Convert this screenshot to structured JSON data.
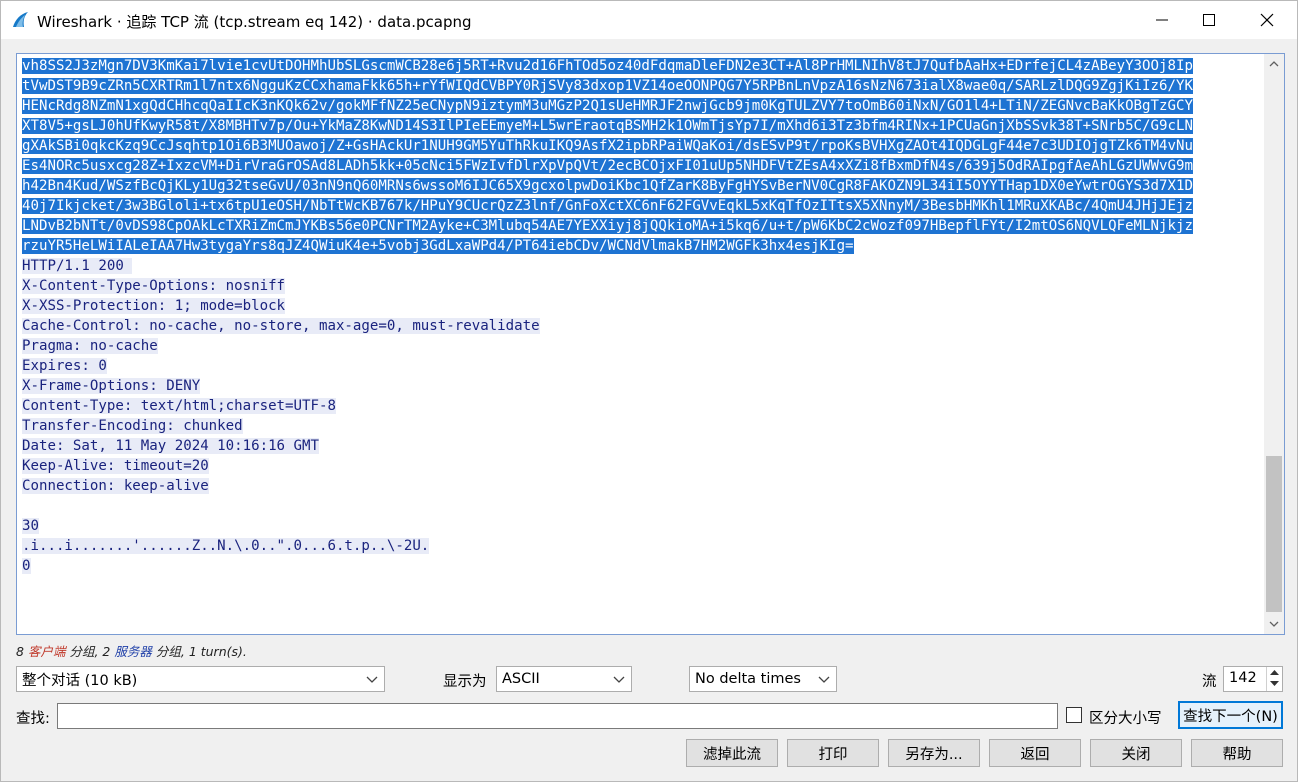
{
  "window": {
    "title": "Wireshark · 追踪 TCP 流 (tcp.stream eq 142) · data.pcapng"
  },
  "stream": {
    "client_lines": [
      "vh8SS2J3zMgn7DV3KmKai7lvie1cvUtDOHMhUbSLGscmWCB28e6j5RT+Rvu2d16FhTOd5oz40dFdqmaDleFDN2e3CT+Al8PrHMLNIhV8tJ7QufbAaHx+EDrfejCL4zABeyY3OOj8Ip",
      "tVwDST9B9cZRn5CXRTRm1l7ntx6NgguKzCCxhamaFkk65h+rYfWIQdCVBPY0RjSVy83dxop1VZ14oeOONPQG7Y5RPBnLnVpzA16sNzN673ialX8wae0q/SARLzlDQG9ZgjKiIz6/YK",
      "HENcRdg8NZmN1xgQdCHhcqQaIIcK3nKQk62v/gokMFfNZ25eCNypN9iztymM3uMGzP2Q1sUeHMRJF2nwjGcb9jm0KgTULZVY7toOmB60iNxN/GO1l4+LTiN/ZEGNvcBaKkOBgTzGCY",
      "XT8V5+gsLJ0hUfKwyR58t/X8MBHTv7p/Ou+YkMaZ8KwND14S3IlPIeEEmyeM+L5wrEraotqBSMH2k1OWmTjsYp7I/mXhd6i3Tz3bfm4RINx+1PCUaGnjXbSSvk38T+SNrb5C/G9cLN",
      "gXAkSBi0qkcKzq9CcJsqhtp1Oi6B3MUOawoj/Z+GsHAckUr1NUH9GM5YuThRkuIKQ9AsfX2ipbRPaiWQaKoi/dsESvP9t/rpoKsBVHXgZAOt4IQDGLgF44e7c3UDIOjgTZk6TM4vNu",
      "Es4NORc5usxcg28Z+IxzcVM+DirVraGrOSAd8LADh5kk+05cNci5FWzIvfDlrXpVpQVt/2ecBCOjxFI01uUp5NHDFVtZEsA4xXZi8fBxmDfN4s/639j5OdRAIpgfAeAhLGzUWWvG9m",
      "h42Bn4Kud/WSzfBcQjKLy1Ug32tseGvU/03nN9nQ60MRNs6wssoM6IJC65X9gcxolpwDoiKbc1QfZarK8ByFgHYSvBerNV0CgR8FAKOZN9L34iI5OYYTHap1DX0eYwtrOGYS3d7X1D",
      "40j7Ikjcket/3w3BGloli+tx6tpU1eOSH/NbTtWcKB767k/HPuY9CUcrQzZ3lnf/GnFoXctXC6nF62FGVvEqkL5xKqTfOzITtsX5XNnyM/3BesbHMKhl1MRuXKABc/4QmU4JHjJEjz",
      "LNDvB2bNTt/0vDS98CpOAkLcTXRiZmCmJYKBs56e0PCNrTM2Ayke+C3Mlubq54AE7YEXXiyj8jQQkioMA+i5kq6/u+t/pW6KbC2cWozf097HBepflFYt/I2mtOS6NQVLQFeMLNjkjz",
      "rzuYR5HeLWiIALeIAA7Hw3tygaYrs8qJZ4QWiuK4e+5vobj3GdLxaWPd4/PT64iebCDv/WCNdVlmakB7HM2WGFk3hx4esjKIg="
    ],
    "server_lines": [
      "HTTP/1.1 200 ",
      "X-Content-Type-Options: nosniff",
      "X-XSS-Protection: 1; mode=block",
      "Cache-Control: no-cache, no-store, max-age=0, must-revalidate",
      "Pragma: no-cache",
      "Expires: 0",
      "X-Frame-Options: DENY",
      "Content-Type: text/html;charset=UTF-8",
      "Transfer-Encoding: chunked",
      "Date: Sat, 11 May 2024 10:16:16 GMT",
      "Keep-Alive: timeout=20",
      "Connection: keep-alive"
    ],
    "chunk_lines": [
      "30",
      ".i...i.......'......Z..N.\\.0..\".0...6.t.p..\\-2U.",
      "0"
    ],
    "selection_color": "#1e73d2",
    "server_bg_color": "#e8ebf7"
  },
  "summary": {
    "client_count": "8",
    "client_label": "客户端",
    "group1": "分组,",
    "server_count": "2",
    "server_label": "服务器",
    "group2": "分组,",
    "turns": "1 turn(s)."
  },
  "controls": {
    "conversation_select": "整个对话 (10 kB)",
    "show_as_label": "显示为",
    "show_as_value": "ASCII",
    "delta_select": "No delta times",
    "stream_label": "流",
    "stream_value": "142",
    "find_label": "查找:",
    "find_value": "",
    "case_label": "区分大小写",
    "find_next": "查找下一个(N)"
  },
  "buttons": {
    "filter_out": "滤掉此流",
    "print": "打印",
    "save_as": "另存为...",
    "back": "返回",
    "close": "关闭",
    "help": "帮助"
  }
}
